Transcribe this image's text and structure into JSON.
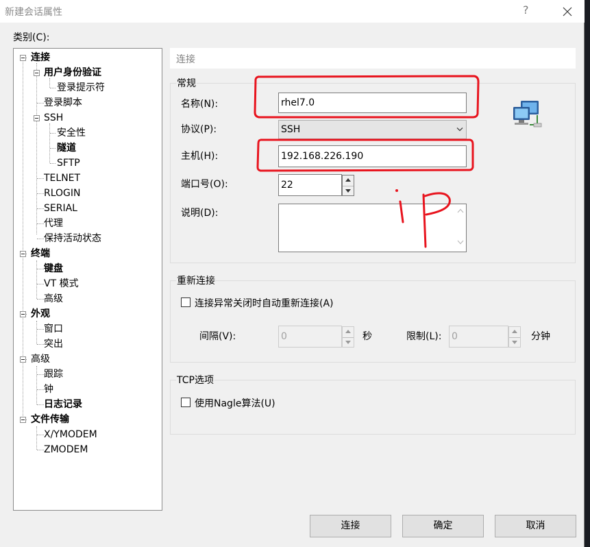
{
  "window": {
    "title": "新建会话属性",
    "help": "?"
  },
  "category_label": "类别(C):",
  "tree": [
    {
      "label": "连接",
      "bold": true
    },
    {
      "label": "用户身份验证",
      "bold": true
    },
    {
      "label": "登录提示符",
      "bold": false
    },
    {
      "label": "登录脚本",
      "bold": false
    },
    {
      "label": "SSH",
      "bold": false
    },
    {
      "label": "安全性",
      "bold": false
    },
    {
      "label": "隧道",
      "bold": true
    },
    {
      "label": "SFTP",
      "bold": false
    },
    {
      "label": "TELNET",
      "bold": false
    },
    {
      "label": "RLOGIN",
      "bold": false
    },
    {
      "label": "SERIAL",
      "bold": false
    },
    {
      "label": "代理",
      "bold": false
    },
    {
      "label": "保持活动状态",
      "bold": false
    },
    {
      "label": "终端",
      "bold": true
    },
    {
      "label": "键盘",
      "bold": true
    },
    {
      "label": "VT 模式",
      "bold": false
    },
    {
      "label": "高级",
      "bold": false
    },
    {
      "label": "外观",
      "bold": true
    },
    {
      "label": "窗口",
      "bold": false
    },
    {
      "label": "突出",
      "bold": false
    },
    {
      "label": "高级",
      "bold": false
    },
    {
      "label": "跟踪",
      "bold": false
    },
    {
      "label": "钟",
      "bold": false
    },
    {
      "label": "日志记录",
      "bold": true
    },
    {
      "label": "文件传输",
      "bold": true
    },
    {
      "label": "X/YMODEM",
      "bold": false
    },
    {
      "label": "ZMODEM",
      "bold": false
    }
  ],
  "section_header": "连接",
  "general": {
    "title": "常规",
    "name_label": "名称(N):",
    "name_value": "rhel7.0",
    "protocol_label": "协议(P):",
    "protocol_value": "SSH",
    "host_label": "主机(H):",
    "host_value": "192.168.226.190",
    "port_label": "端口号(O):",
    "port_value": "22",
    "desc_label": "说明(D):"
  },
  "reconnect": {
    "title": "重新连接",
    "auto_label": "连接异常关闭时自动重新连接(A)",
    "interval_label": "间隔(V):",
    "interval_value": "0",
    "interval_unit": "秒",
    "limit_label": "限制(L):",
    "limit_value": "0",
    "limit_unit": "分钟"
  },
  "tcp": {
    "title": "TCP选项",
    "nagle_label": "使用Nagle算法(U)"
  },
  "buttons": {
    "connect": "连接",
    "ok": "确定",
    "cancel": "取消"
  },
  "annotation": {
    "color": "#e8141e"
  }
}
